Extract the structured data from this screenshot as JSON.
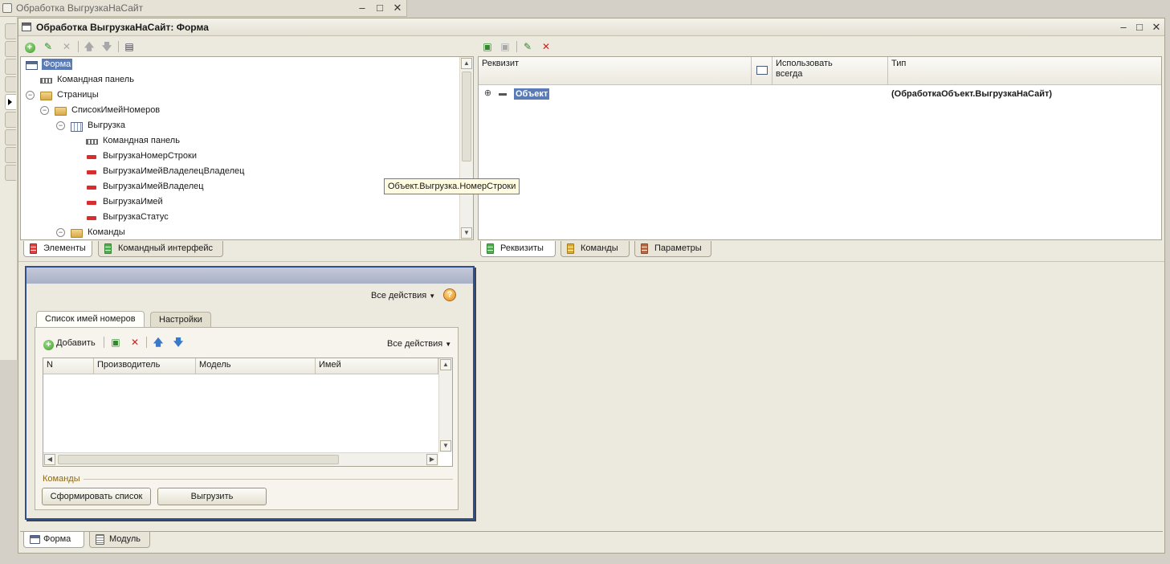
{
  "outer_window": {
    "title": "Обработка ВыгрузкаНаСайт"
  },
  "main_window": {
    "title": "Обработка ВыгрузкаНаСайт: Форма"
  },
  "elements_tree": {
    "items": [
      {
        "label": "Форма"
      },
      {
        "label": "Командная панель"
      },
      {
        "label": "Страницы"
      },
      {
        "label": "СписокИмейНомеров"
      },
      {
        "label": "Выгрузка"
      },
      {
        "label": "Командная панель"
      },
      {
        "label": "ВыгрузкаНомерСтроки"
      },
      {
        "label": "ВыгрузкаИмейВладелецВладелец"
      },
      {
        "label": "ВыгрузкаИмейВладелец"
      },
      {
        "label": "ВыгрузкаИмей"
      },
      {
        "label": "ВыгрузкаСтатус"
      },
      {
        "label": "Команды"
      }
    ],
    "tabs": [
      {
        "label": "Элементы"
      },
      {
        "label": "Командный интерфейс"
      }
    ]
  },
  "attributes": {
    "columns": {
      "rekvizit": "Реквизит",
      "use_always_line1": "Использовать",
      "use_always_line2": "всегда",
      "type": "Тип"
    },
    "rows": [
      {
        "name": "Объект",
        "type": "(ОбработкаОбъект.ВыгрузкаНаСайт)"
      }
    ],
    "tabs": [
      {
        "label": "Реквизиты"
      },
      {
        "label": "Команды"
      },
      {
        "label": "Параметры"
      }
    ]
  },
  "tooltip": {
    "text": "Объект.Выгрузка.НомерСтроки"
  },
  "preview": {
    "all_actions_top": "Все действия",
    "help_glyph": "?",
    "tabs": [
      {
        "label": "Список имей номеров"
      },
      {
        "label": "Настройки"
      }
    ],
    "add_label": "Добавить",
    "all_actions_inner": "Все действия",
    "grid_columns": [
      "N",
      "Производитель",
      "Модель",
      "Имей"
    ],
    "commands_group": "Команды",
    "buttons": {
      "generate": "Сформировать список",
      "upload": "Выгрузить"
    }
  },
  "bottom_tabs": [
    {
      "label": "Форма"
    },
    {
      "label": "Модуль"
    }
  ],
  "icons": {
    "minimize": "minimize-icon",
    "restore": "restore-icon",
    "close": "close-icon"
  }
}
